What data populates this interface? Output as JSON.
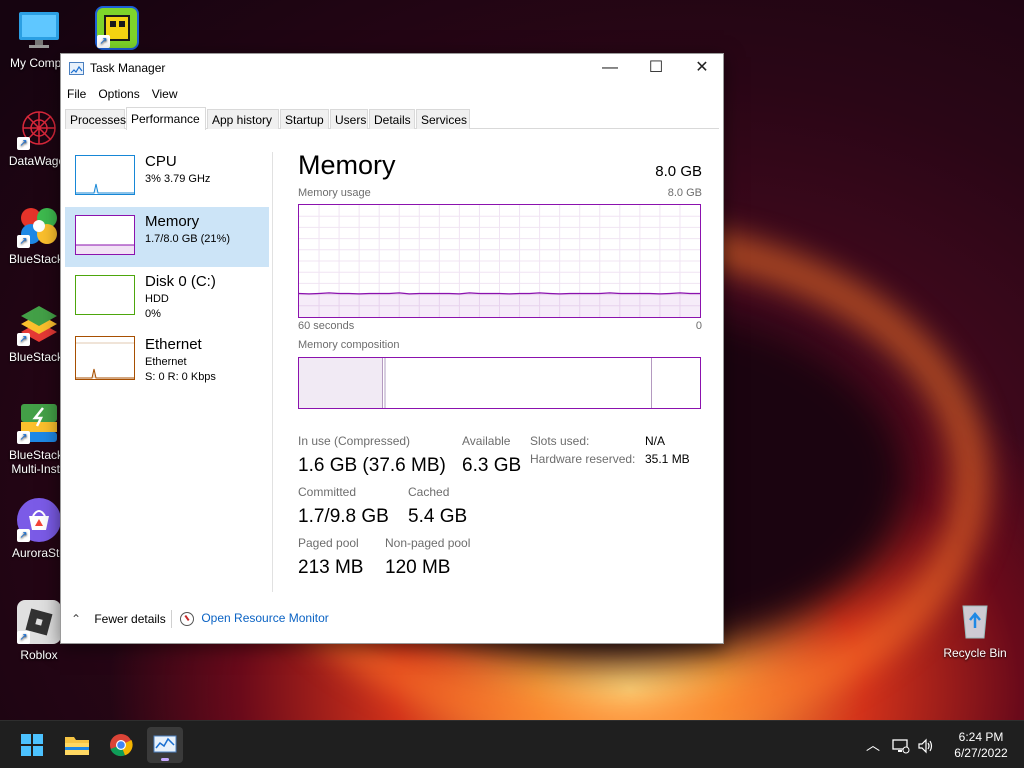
{
  "desktop": {
    "icons": [
      {
        "label": "My Compu",
        "icon": "computer-icon"
      },
      {
        "label": "DataWagor",
        "icon": "datawagon-icon"
      },
      {
        "label": "BlueStacks",
        "icon": "bluestacks-x-icon"
      },
      {
        "label": "BlueStacks",
        "icon": "bluestacks-icon"
      },
      {
        "label": "BlueStacks Multi-Insta",
        "icon": "bluestacks-multi-instance-icon"
      },
      {
        "label": "AuroraSto",
        "icon": "aurora-store-icon"
      },
      {
        "label": "Roblox",
        "icon": "roblox-icon"
      },
      {
        "label": "Recycle Bin",
        "icon": "recycle-bin-icon"
      }
    ]
  },
  "window": {
    "title": "Task Manager",
    "controls": {
      "minimize": "—",
      "maximize": "☐",
      "close": "✕"
    },
    "menu": [
      "File",
      "Options",
      "View"
    ],
    "tabs": [
      "Processes",
      "Performance",
      "App history",
      "Startup",
      "Users",
      "Details",
      "Services"
    ],
    "active_tab": "Performance"
  },
  "sidebar": {
    "items": [
      {
        "title": "CPU",
        "line1": "3% 3.79 GHz",
        "line2": "",
        "color": "#1787d6"
      },
      {
        "title": "Memory",
        "line1": "1.7/8.0 GB (21%)",
        "line2": "",
        "color": "#8b12ae",
        "selected": true
      },
      {
        "title": "Disk 0 (C:)",
        "line1": "HDD",
        "line2": "0%",
        "color": "#4da60c"
      },
      {
        "title": "Ethernet",
        "line1": "Ethernet",
        "line2": "S: 0 R: 0 Kbps",
        "color": "#a74f01"
      }
    ]
  },
  "memory": {
    "title": "Memory",
    "total": "8.0 GB",
    "usage_label": "Memory usage",
    "usage_max": "8.0 GB",
    "axis_left": "60 seconds",
    "axis_right": "0",
    "composition_label": "Memory composition",
    "in_use_label": "In use (Compressed)",
    "in_use_value": "1.6 GB (37.6 MB)",
    "available_label": "Available",
    "available_value": "6.3 GB",
    "committed_label": "Committed",
    "committed_value": "1.7/9.8 GB",
    "cached_label": "Cached",
    "cached_value": "5.4 GB",
    "paged_label": "Paged pool",
    "paged_value": "213 MB",
    "nonpaged_label": "Non-paged pool",
    "nonpaged_value": "120 MB",
    "slots_label": "Slots used:",
    "slots_value": "N/A",
    "reserved_label": "Hardware reserved:",
    "reserved_value": "35.1 MB",
    "usage_fraction": 0.21
  },
  "footer": {
    "fewer_details": "Fewer details",
    "open_monitor": "Open Resource Monitor"
  },
  "taskbar": {
    "time": "6:24 PM",
    "date": "6/27/2022"
  }
}
